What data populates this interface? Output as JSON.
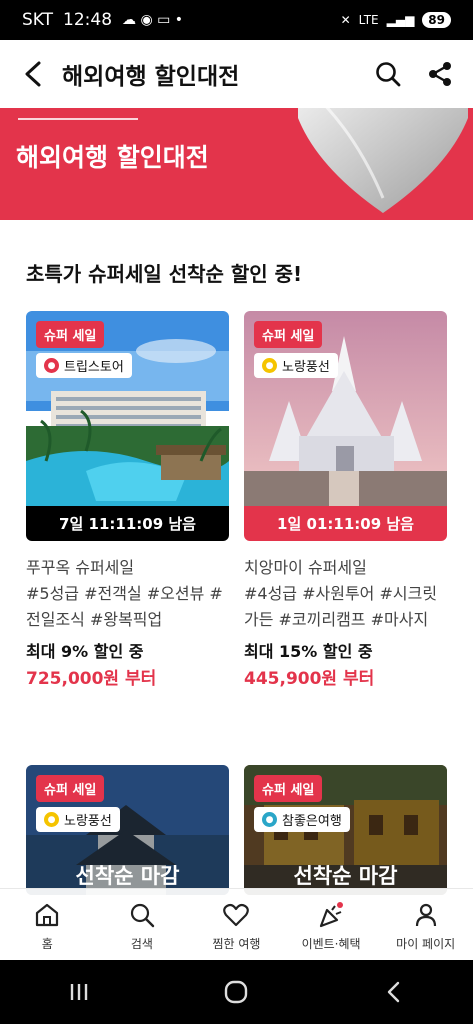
{
  "status_bar": {
    "carrier": "SKT",
    "time": "12:48",
    "network": "LTE",
    "battery": "89"
  },
  "app_bar": {
    "title": "해외여행 할인대전"
  },
  "banner": {
    "title": "해외여행 할인대전",
    "bg_color": "#e3344b"
  },
  "section": {
    "title": "초특가 슈퍼세일 선착순 할인 중!"
  },
  "cards": [
    {
      "badge": "슈퍼 세일",
      "seller": "트립스토어",
      "timer": "7일 11:11:09 남음",
      "timer_color": "#000000",
      "name": "푸꾸옥 슈퍼세일",
      "tags": "#5성급 #전객실 #오션뷰 #전일조식 #왕복픽업",
      "discount": "최대 9% 할인 중",
      "price": "725,000원 부터"
    },
    {
      "badge": "슈퍼 세일",
      "seller": "노랑풍선",
      "timer": "1일 01:11:09 남음",
      "timer_color": "#e3344b",
      "name": "치앙마이 슈퍼세일",
      "tags": "#4성급 #사원투어 #시크릿가든 #코끼리캠프 #마사지",
      "discount": "최대 15% 할인 중",
      "price": "445,900원 부터"
    }
  ],
  "closed_cards": [
    {
      "badge": "슈퍼 세일",
      "seller": "노랑풍선",
      "status": "선착순 마감"
    },
    {
      "badge": "슈퍼 세일",
      "seller": "참좋은여행",
      "status": "선착순 마감"
    }
  ],
  "bottom_nav": [
    {
      "label": "홈",
      "icon": "home-icon"
    },
    {
      "label": "검색",
      "icon": "search-icon"
    },
    {
      "label": "찜한 여행",
      "icon": "heart-icon"
    },
    {
      "label": "이벤트·혜택",
      "icon": "party-popper-icon"
    },
    {
      "label": "마이 페이지",
      "icon": "person-icon"
    }
  ]
}
